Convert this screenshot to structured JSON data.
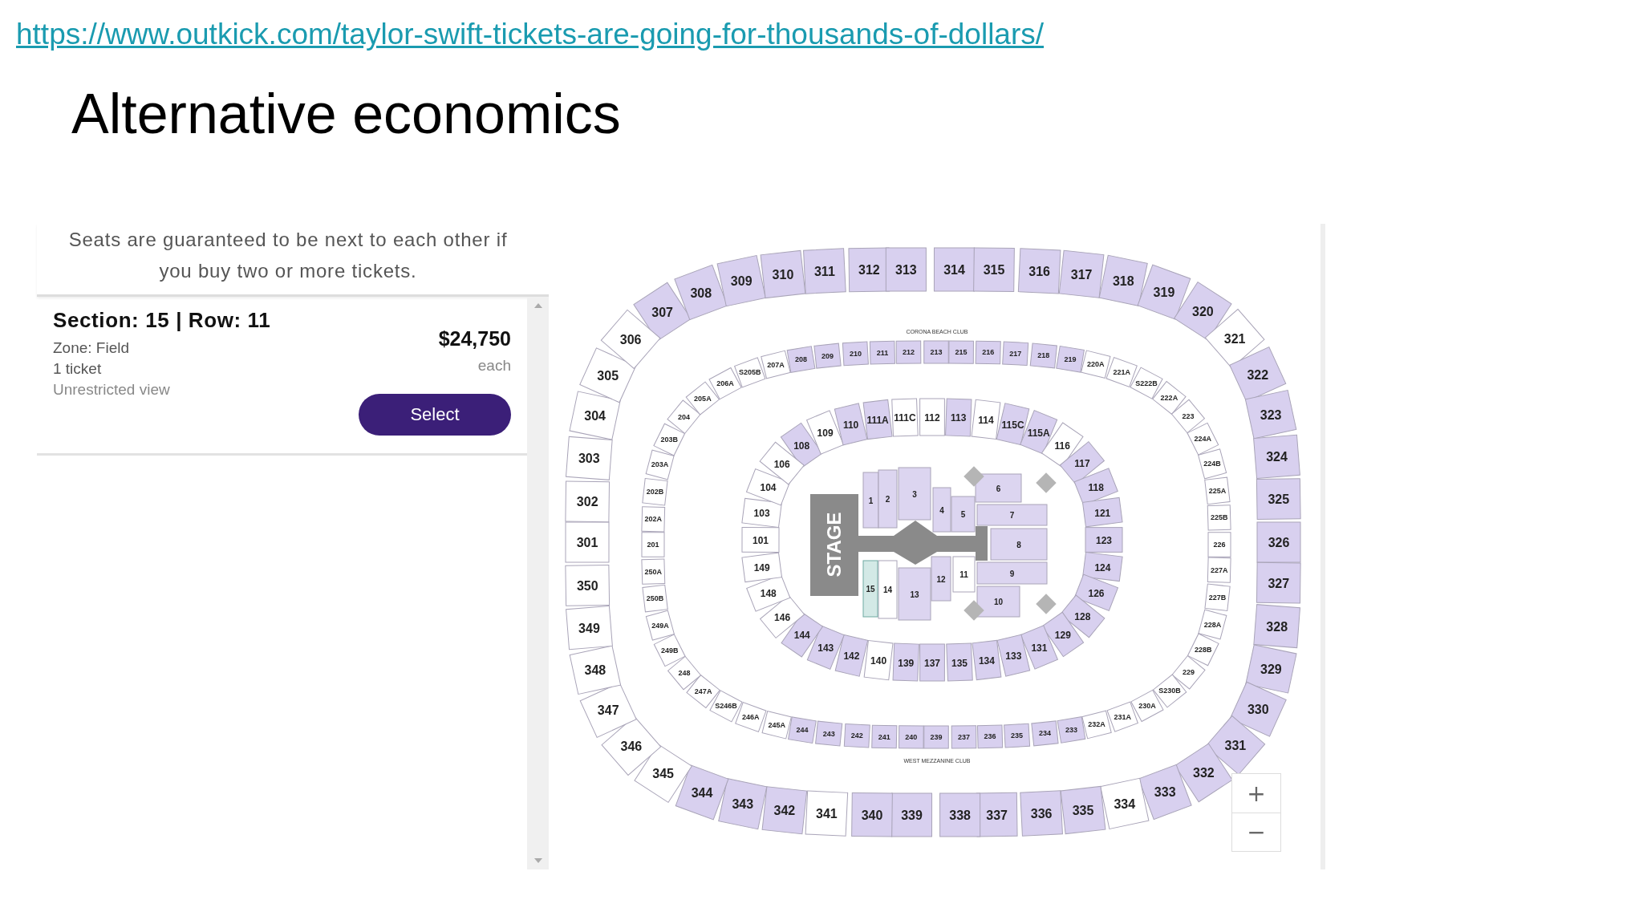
{
  "url": "https://www.outkick.com/taylor-swift-tickets-are-going-for-thousands-of-dollars/",
  "title": "Alternative economics",
  "listing_panel": {
    "notice": "Seats are guaranteed to be next to each other if you buy two or more tickets.",
    "listing": {
      "heading": "Section: 15 | Row: 11",
      "zone": "Zone: Field",
      "quantity": "1 ticket",
      "view": "Unrestricted view",
      "price": "$24,750",
      "price_unit": "each",
      "button": "Select"
    }
  },
  "seat_map": {
    "upper_ring": {
      "top": [
        {
          "label": "307",
          "available": true
        },
        {
          "label": "308",
          "available": true
        },
        {
          "label": "309",
          "available": true
        },
        {
          "label": "310",
          "available": true
        },
        {
          "label": "311",
          "available": true
        },
        {
          "label": "312",
          "available": true
        },
        {
          "label": "313",
          "available": true
        },
        {
          "label": "314",
          "available": true
        },
        {
          "label": "315",
          "available": true
        },
        {
          "label": "316",
          "available": true
        },
        {
          "label": "317",
          "available": true
        },
        {
          "label": "318",
          "available": true
        },
        {
          "label": "319",
          "available": true
        },
        {
          "label": "320",
          "available": true
        }
      ],
      "left": [
        {
          "label": "306",
          "available": false
        },
        {
          "label": "305",
          "available": false
        },
        {
          "label": "304",
          "available": false
        },
        {
          "label": "303",
          "available": false
        },
        {
          "label": "302",
          "available": false
        },
        {
          "label": "301",
          "available": false
        },
        {
          "label": "350",
          "available": false
        },
        {
          "label": "349",
          "available": false
        },
        {
          "label": "348",
          "available": false
        },
        {
          "label": "347",
          "available": false
        },
        {
          "label": "346",
          "available": false
        }
      ],
      "right": [
        {
          "label": "321",
          "available": false
        },
        {
          "label": "322",
          "available": true
        },
        {
          "label": "323",
          "available": true
        },
        {
          "label": "324",
          "available": true
        },
        {
          "label": "325",
          "available": true
        },
        {
          "label": "326",
          "available": true
        },
        {
          "label": "327",
          "available": true
        },
        {
          "label": "328",
          "available": true
        },
        {
          "label": "329",
          "available": true
        },
        {
          "label": "330",
          "available": true
        },
        {
          "label": "331",
          "available": true
        }
      ],
      "bottom": [
        {
          "label": "345",
          "available": false
        },
        {
          "label": "344",
          "available": true
        },
        {
          "label": "343",
          "available": true
        },
        {
          "label": "342",
          "available": true
        },
        {
          "label": "341",
          "available": false
        },
        {
          "label": "340",
          "available": true
        },
        {
          "label": "339",
          "available": true
        },
        {
          "label": "338",
          "available": true
        },
        {
          "label": "337",
          "available": true
        },
        {
          "label": "336",
          "available": true
        },
        {
          "label": "335",
          "available": true
        },
        {
          "label": "334",
          "available": false
        },
        {
          "label": "333",
          "available": true
        },
        {
          "label": "332",
          "available": true
        }
      ]
    },
    "club_labels": [
      "CORONA BEACH CLUB",
      "WEST MEZZANINE CLUB"
    ],
    "mezzanine_ring": {
      "top": [
        {
          "label": "207A",
          "available": false
        },
        {
          "label": "208",
          "available": true
        },
        {
          "label": "209",
          "available": true
        },
        {
          "label": "210",
          "available": true
        },
        {
          "label": "211",
          "available": true
        },
        {
          "label": "212",
          "available": true
        },
        {
          "label": "213",
          "available": true
        },
        {
          "label": "215",
          "available": true
        },
        {
          "label": "216",
          "available": true
        },
        {
          "label": "217",
          "available": true
        },
        {
          "label": "218",
          "available": true
        },
        {
          "label": "219",
          "available": true
        },
        {
          "label": "220A",
          "available": false
        }
      ],
      "left": [
        {
          "label": "S205B",
          "available": false
        },
        {
          "label": "206A",
          "available": false
        },
        {
          "label": "205A",
          "available": false
        },
        {
          "label": "204",
          "available": false
        },
        {
          "label": "203B",
          "available": false
        },
        {
          "label": "203A",
          "available": false
        },
        {
          "label": "202B",
          "available": false
        },
        {
          "label": "202A",
          "available": false
        },
        {
          "label": "201",
          "available": false
        },
        {
          "label": "250A",
          "available": false
        },
        {
          "label": "250B",
          "available": false
        },
        {
          "label": "249A",
          "available": false
        },
        {
          "label": "249B",
          "available": false
        },
        {
          "label": "248",
          "available": false
        },
        {
          "label": "247A",
          "available": false
        },
        {
          "label": "S246B",
          "available": false
        },
        {
          "label": "246A",
          "available": false
        }
      ],
      "right": [
        {
          "label": "221A",
          "available": false
        },
        {
          "label": "S222B",
          "available": false
        },
        {
          "label": "222A",
          "available": false
        },
        {
          "label": "223",
          "available": false
        },
        {
          "label": "224A",
          "available": false
        },
        {
          "label": "224B",
          "available": false
        },
        {
          "label": "225A",
          "available": false
        },
        {
          "label": "225B",
          "available": false
        },
        {
          "label": "226",
          "available": false
        },
        {
          "label": "227A",
          "available": false
        },
        {
          "label": "227B",
          "available": false
        },
        {
          "label": "228A",
          "available": false
        },
        {
          "label": "228B",
          "available": false
        },
        {
          "label": "229",
          "available": false
        },
        {
          "label": "S230B",
          "available": false
        },
        {
          "label": "230A",
          "available": false
        },
        {
          "label": "231A",
          "available": false
        }
      ],
      "bottom": [
        {
          "label": "245A",
          "available": false
        },
        {
          "label": "244",
          "available": true
        },
        {
          "label": "243",
          "available": true
        },
        {
          "label": "242",
          "available": true
        },
        {
          "label": "241",
          "available": true
        },
        {
          "label": "240",
          "available": true
        },
        {
          "label": "239",
          "available": true
        },
        {
          "label": "237",
          "available": true
        },
        {
          "label": "236",
          "available": true
        },
        {
          "label": "235",
          "available": true
        },
        {
          "label": "234",
          "available": true
        },
        {
          "label": "233",
          "available": true
        },
        {
          "label": "232A",
          "available": false
        }
      ]
    },
    "lower_ring": {
      "top": [
        {
          "label": "108",
          "available": true
        },
        {
          "label": "109",
          "available": false
        },
        {
          "label": "110",
          "available": true
        },
        {
          "label": "111A",
          "available": true
        },
        {
          "label": "111C",
          "available": false
        },
        {
          "label": "112",
          "available": false
        },
        {
          "label": "113",
          "available": true
        },
        {
          "label": "114",
          "available": false
        },
        {
          "label": "115C",
          "available": true
        },
        {
          "label": "115A",
          "available": true
        },
        {
          "label": "116",
          "available": false
        },
        {
          "label": "117",
          "available": true
        },
        {
          "label": "118",
          "available": true
        }
      ],
      "left": [
        {
          "label": "106",
          "available": false
        },
        {
          "label": "104",
          "available": false
        },
        {
          "label": "103",
          "available": false
        },
        {
          "label": "101",
          "available": false
        },
        {
          "label": "149",
          "available": false
        },
        {
          "label": "148",
          "available": false
        },
        {
          "label": "146",
          "available": false
        }
      ],
      "right": [
        {
          "label": "121",
          "available": true
        },
        {
          "label": "123",
          "available": true
        },
        {
          "label": "124",
          "available": true
        },
        {
          "label": "126",
          "available": true
        },
        {
          "label": "128",
          "available": true
        },
        {
          "label": "129",
          "available": true
        },
        {
          "label": "131",
          "available": true
        }
      ],
      "bottom": [
        {
          "label": "144",
          "available": true
        },
        {
          "label": "143",
          "available": true
        },
        {
          "label": "142",
          "available": true
        },
        {
          "label": "140",
          "available": false
        },
        {
          "label": "139",
          "available": true
        },
        {
          "label": "137",
          "available": true
        },
        {
          "label": "135",
          "available": true
        },
        {
          "label": "134",
          "available": true
        },
        {
          "label": "133",
          "available": true
        }
      ]
    },
    "stage": "STAGE",
    "field_sections": [
      {
        "label": "1",
        "available": true,
        "selected": false
      },
      {
        "label": "2",
        "available": true,
        "selected": false
      },
      {
        "label": "3",
        "available": true,
        "selected": false
      },
      {
        "label": "6",
        "available": true,
        "selected": false
      },
      {
        "label": "4",
        "available": true,
        "selected": false
      },
      {
        "label": "5",
        "available": true,
        "selected": false
      },
      {
        "label": "7",
        "available": true,
        "selected": false
      },
      {
        "label": "8",
        "available": true,
        "selected": false
      },
      {
        "label": "9",
        "available": true,
        "selected": false
      },
      {
        "label": "14",
        "available": false,
        "selected": false
      },
      {
        "label": "11",
        "available": false,
        "selected": false
      },
      {
        "label": "12",
        "available": true,
        "selected": false
      },
      {
        "label": "13",
        "available": true,
        "selected": false
      },
      {
        "label": "15",
        "available": true,
        "selected": true
      },
      {
        "label": "10",
        "available": true,
        "selected": false
      }
    ],
    "zoom_controls": [
      "+",
      "−"
    ]
  }
}
